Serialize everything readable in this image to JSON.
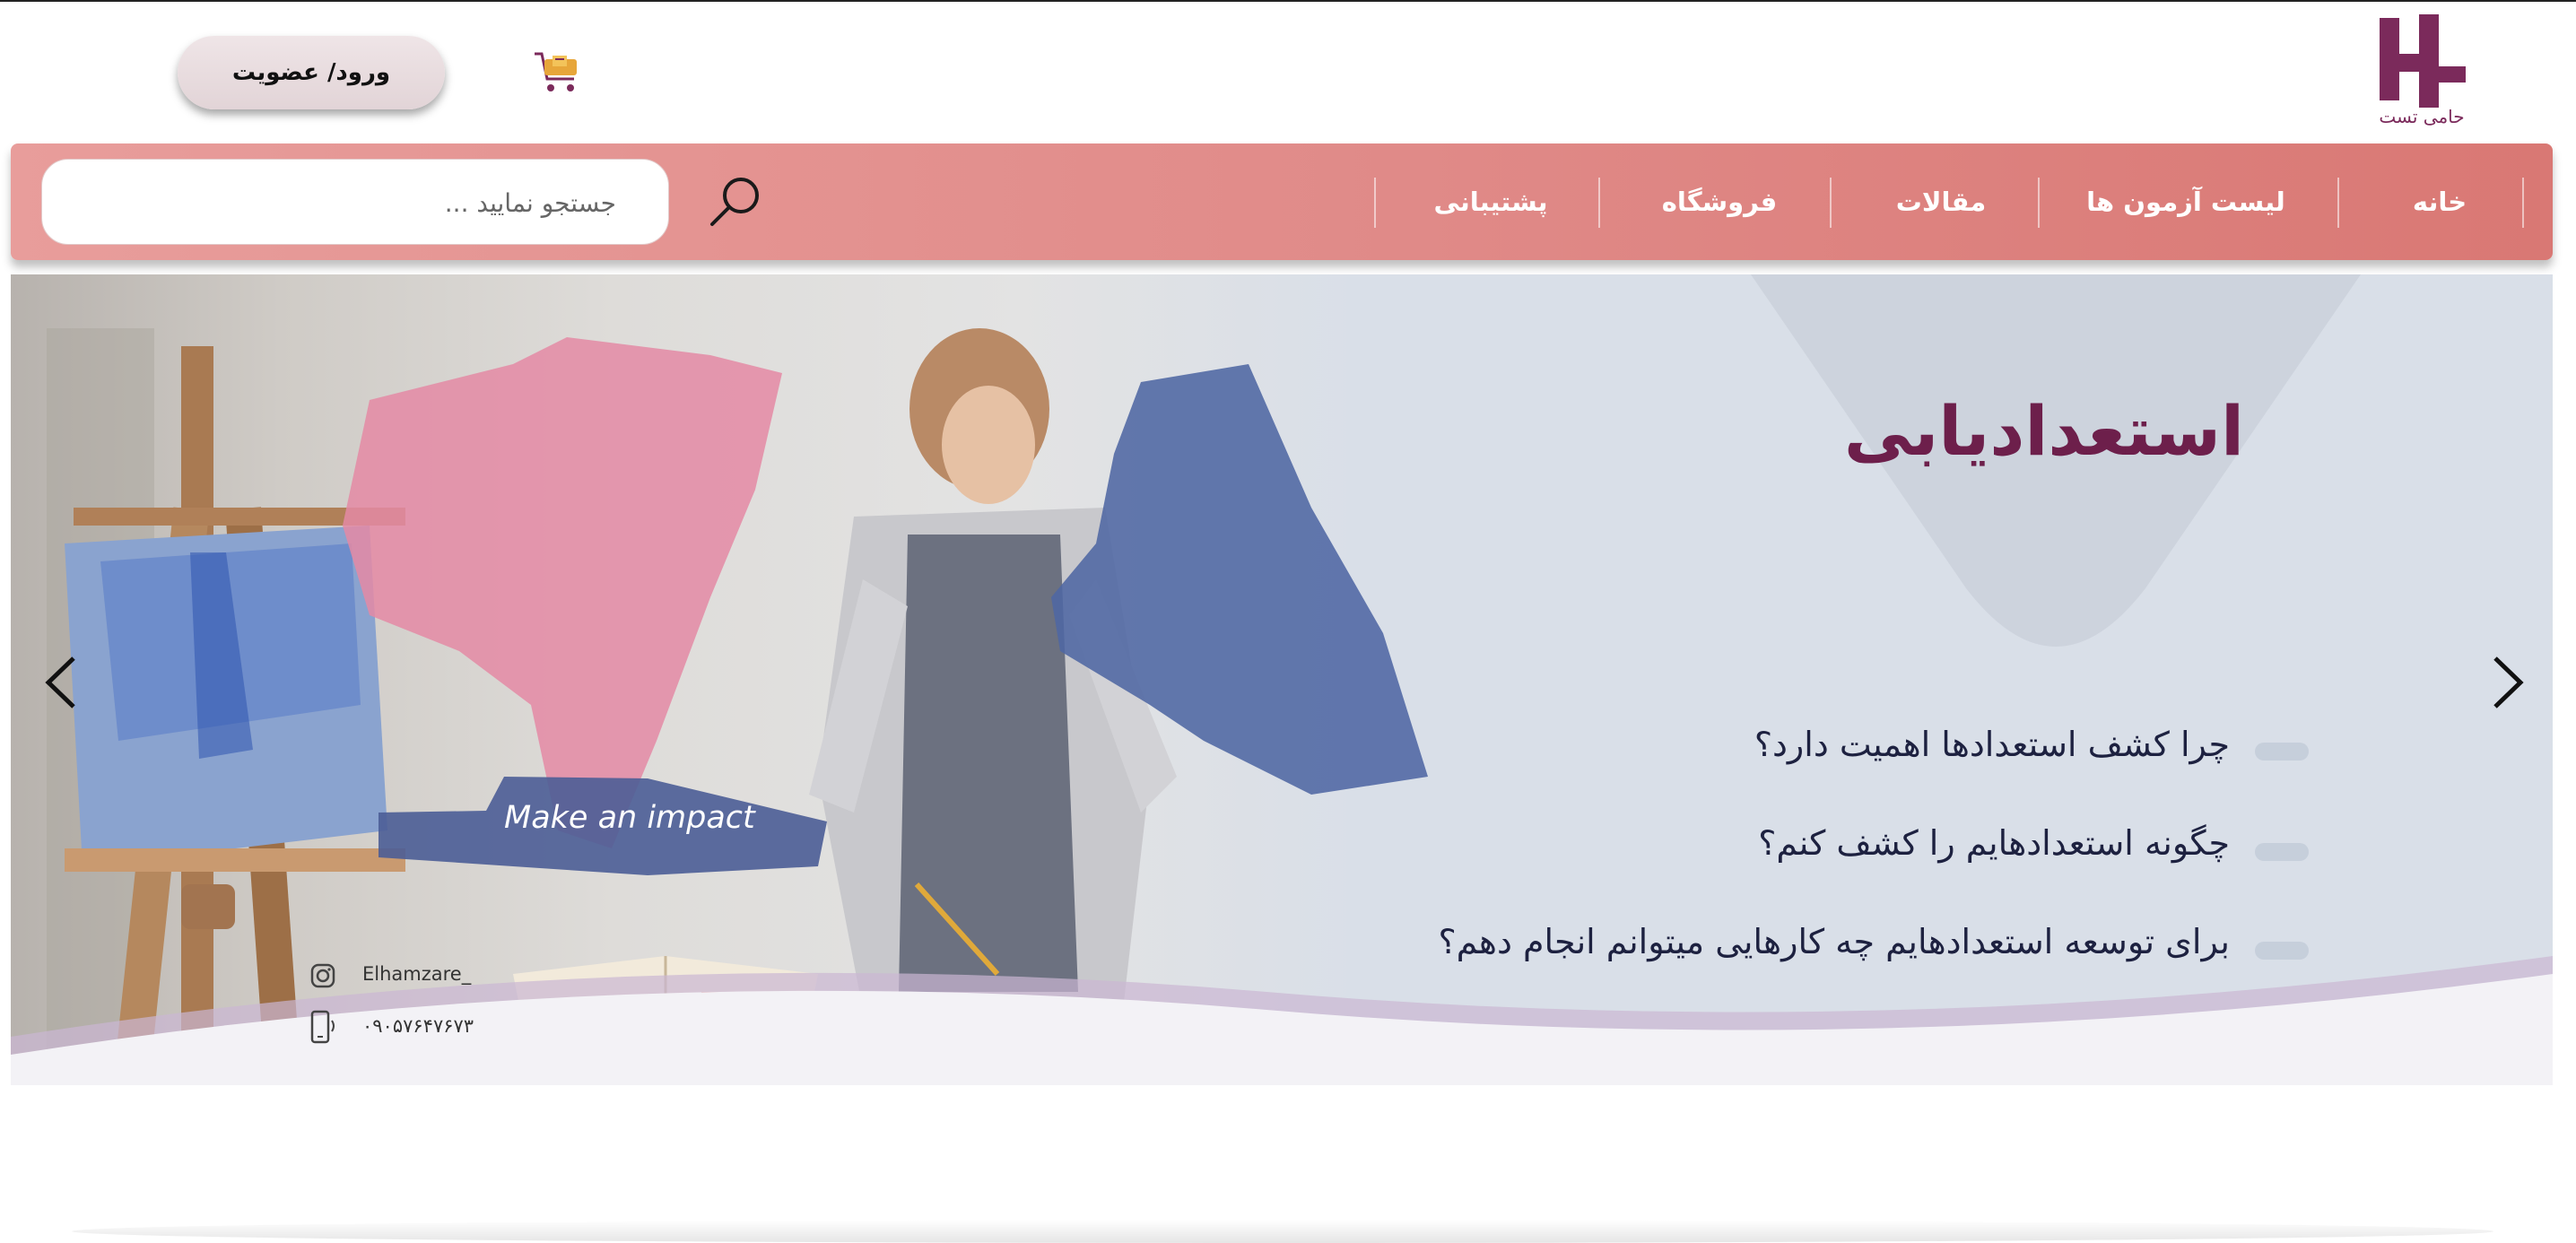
{
  "header": {
    "logo_name": "حامی تست",
    "login_label": "ورود/ عضویت",
    "brand_color": "#7b2a5b",
    "cart_icon": "cart-icon"
  },
  "nav": {
    "items": [
      {
        "label": "خانه"
      },
      {
        "label": "لیست آزمون ها"
      },
      {
        "label": "مقالات"
      },
      {
        "label": "فروشگاه"
      },
      {
        "label": "پشتیبانی"
      }
    ],
    "search": {
      "placeholder": "جستجو نمایید ..."
    },
    "bar_color": "#e08a88"
  },
  "hero": {
    "title": "استعدادیابی",
    "questions": [
      {
        "text": "چرا کشف استعدادها اهمیت دارد؟"
      },
      {
        "text": "چگونه استعدادهایم را کشف کنم؟"
      },
      {
        "text": "برای توسعه استعدادهایم چه کارهایی میتوانم انجام دهم؟"
      }
    ],
    "image_caption": "Make an impact",
    "instagram": "Elhamzare_",
    "phone": "۰۹۰۵۷۶۴۷۶۷۳",
    "title_color": "#6d1f4b",
    "prev_icon": "chevron-left-icon",
    "next_icon": "chevron-right-icon"
  }
}
